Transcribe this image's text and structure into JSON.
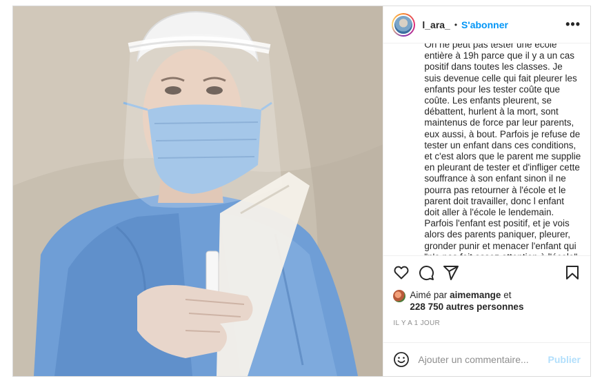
{
  "post": {
    "username": "l_ara_",
    "separator": "•",
    "follow_label": "S'abonner",
    "more_label": "•••",
    "caption": "On ne peut pas tester une école entière à 19h parce que il y a un cas positif dans toutes les classes. Je suis devenue celle qui fait pleurer les enfants pour les tester coûte que coûte. Les enfants pleurent, se débattent, hurlent à la mort, sont maintenus de force par leur parents, eux aussi, à bout. Parfois je refuse de tester un enfant dans ces conditions, et c'est alors que le parent me supplie en pleurant de tester et d'infliger cette souffrance à son enfant sinon il ne pourra pas retourner à l'école et le parent doit travailler, donc l enfant doit aller à l'école le lendemain. Parfois l'enfant est positif, et je vois alors des parents paniquer, pleurer, gronder punir et menacer l'enfant qui \"n'a pas fait assez attention à l'école\". Parfois",
    "liked_by_prefix": "Aimé par",
    "liked_by_user": "aimemange",
    "liked_by_and": "et",
    "others_count": "228 750 autres personnes",
    "time_ago": "IL Y A 1 JOUR",
    "comment_placeholder": "Ajouter un commentaire...",
    "publish_label": "Publier"
  },
  "icons": {
    "like": "heart-icon",
    "comment": "comment-icon",
    "share": "share-icon",
    "save": "bookmark-icon",
    "emoji": "emoji-icon"
  },
  "colors": {
    "accent": "#0095f6",
    "publish_disabled": "#b2dffc",
    "muted": "#8e8e8e",
    "text": "#262626"
  }
}
